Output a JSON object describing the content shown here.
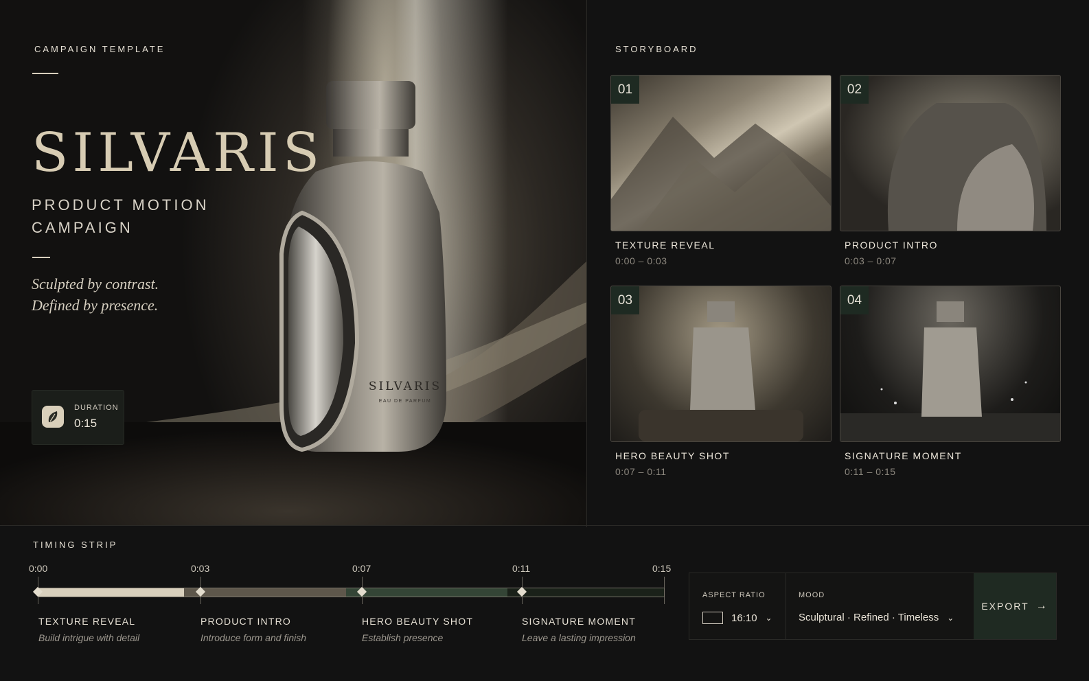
{
  "hero": {
    "eyebrow": "CAMPAIGN TEMPLATE",
    "brand": "SILVARIS",
    "subtitle": "PRODUCT MOTION CAMPAIGN",
    "tagline_line1": "Sculpted by contrast.",
    "tagline_line2": "Defined by presence.",
    "bottle_brand": "SILVARIS",
    "bottle_sub": "EAU DE PARFUM",
    "duration": {
      "label": "DURATION",
      "value": "0:15",
      "icon": "leaf-icon"
    }
  },
  "storyboard": {
    "title": "STORYBOARD",
    "scenes": [
      {
        "num": "01",
        "title": "TEXTURE REVEAL",
        "time": "0:00 – 0:03"
      },
      {
        "num": "02",
        "title": "PRODUCT INTRO",
        "time": "0:03 – 0:07"
      },
      {
        "num": "03",
        "title": "HERO BEAUTY SHOT",
        "time": "0:07 – 0:11"
      },
      {
        "num": "04",
        "title": "SIGNATURE MOMENT",
        "time": "0:11 – 0:15"
      }
    ]
  },
  "timing": {
    "title": "TIMING STRIP",
    "ticks": [
      "0:00",
      "0:03",
      "0:07",
      "0:11",
      "0:15"
    ],
    "phases": [
      {
        "title": "TEXTURE REVEAL",
        "desc": "Build intrigue with detail",
        "color": "#d9d0bd"
      },
      {
        "title": "PRODUCT INTRO",
        "desc": "Introduce form and finish",
        "color": "#5e574b"
      },
      {
        "title": "HERO BEAUTY SHOT",
        "desc": "Establish presence",
        "color": "#344536"
      },
      {
        "title": "SIGNATURE MOMENT",
        "desc": "Leave a lasting impression",
        "color": "#1a2119"
      }
    ]
  },
  "controls": {
    "aspect_label": "ASPECT RATIO",
    "aspect_value": "16:10",
    "mood_label": "MOOD",
    "mood_value": "Sculptural · Refined · Timeless",
    "export_label": "EXPORT"
  }
}
